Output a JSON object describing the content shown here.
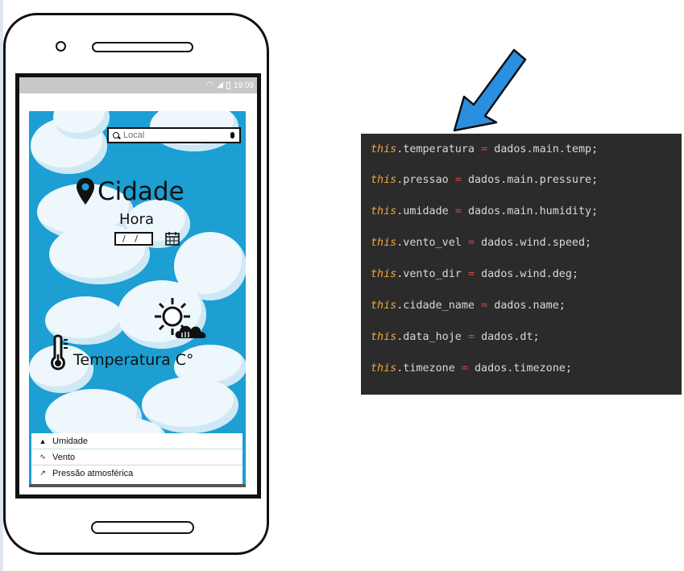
{
  "statusbar": {
    "time": "19:09"
  },
  "app": {
    "search_placeholder": "Local",
    "city": "Cidade",
    "hour": "Hora",
    "date": "/ /",
    "temperature": "Temperatura C°",
    "info": [
      {
        "icon": "drop-icon",
        "label": "Umidade"
      },
      {
        "icon": "wind-icon",
        "label": "Vento"
      },
      {
        "icon": "pressure-icon",
        "label": "Pressão atmosférica"
      }
    ]
  },
  "code": {
    "lines": [
      {
        "kw": "this",
        "prop": ".temperatura",
        "op": "=",
        "rhs": "dados.main.temp;"
      },
      {
        "kw": "this",
        "prop": ".pressao",
        "op": "=",
        "rhs": "dados.main.pressure;"
      },
      {
        "kw": "this",
        "prop": ".umidade",
        "op": "=",
        "rhs": "dados.main.humidity;"
      },
      {
        "kw": "this",
        "prop": ".vento_vel",
        "op": "=",
        "rhs": "dados.wind.speed;"
      },
      {
        "kw": "this",
        "prop": ".vento_dir",
        "op": "=",
        "rhs": "dados.wind.deg;"
      },
      {
        "kw": "this",
        "prop": ".cidade_name",
        "op": "=",
        "rhs": "dados.name;"
      },
      {
        "kw": "this",
        "prop": ".data_hoje",
        "op": "=",
        "rhs": "dados.dt;"
      },
      {
        "kw": "this",
        "prop": ".timezone",
        "op": "=",
        "rhs": "dados.timezone;"
      }
    ]
  },
  "colors": {
    "sky": "#1d9fd3",
    "code_bg": "#2b2b2b",
    "keyword": "#f0a63e",
    "operator": "#d24949",
    "arrow": "#2b8fe0"
  }
}
